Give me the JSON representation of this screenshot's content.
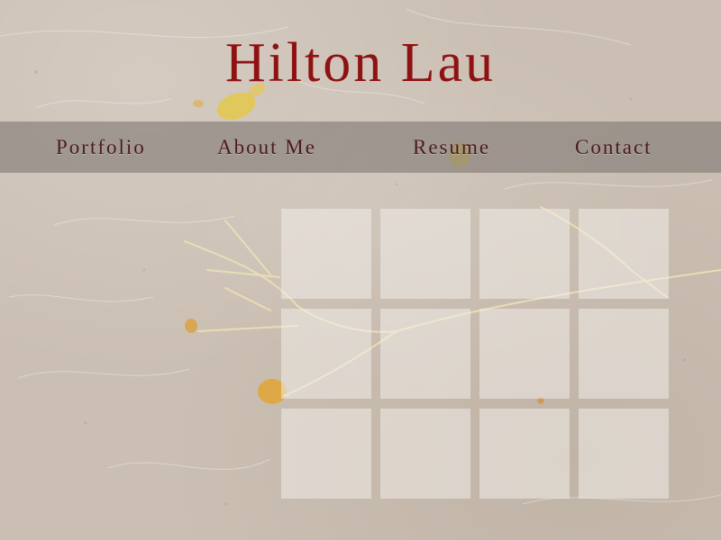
{
  "site": {
    "title": "Hilton Lau"
  },
  "nav": {
    "items": [
      {
        "label": "Portfolio"
      },
      {
        "label": "About Me"
      },
      {
        "label": "Resume"
      },
      {
        "label": "Contact"
      }
    ]
  },
  "gallery": {
    "rows": 3,
    "columns": 4
  },
  "colors": {
    "title": "#8e1212",
    "nav_text": "#4b1a1e",
    "nav_bar": "#76706c",
    "background": "#cbbfb3",
    "tile": "#f0ece8"
  }
}
